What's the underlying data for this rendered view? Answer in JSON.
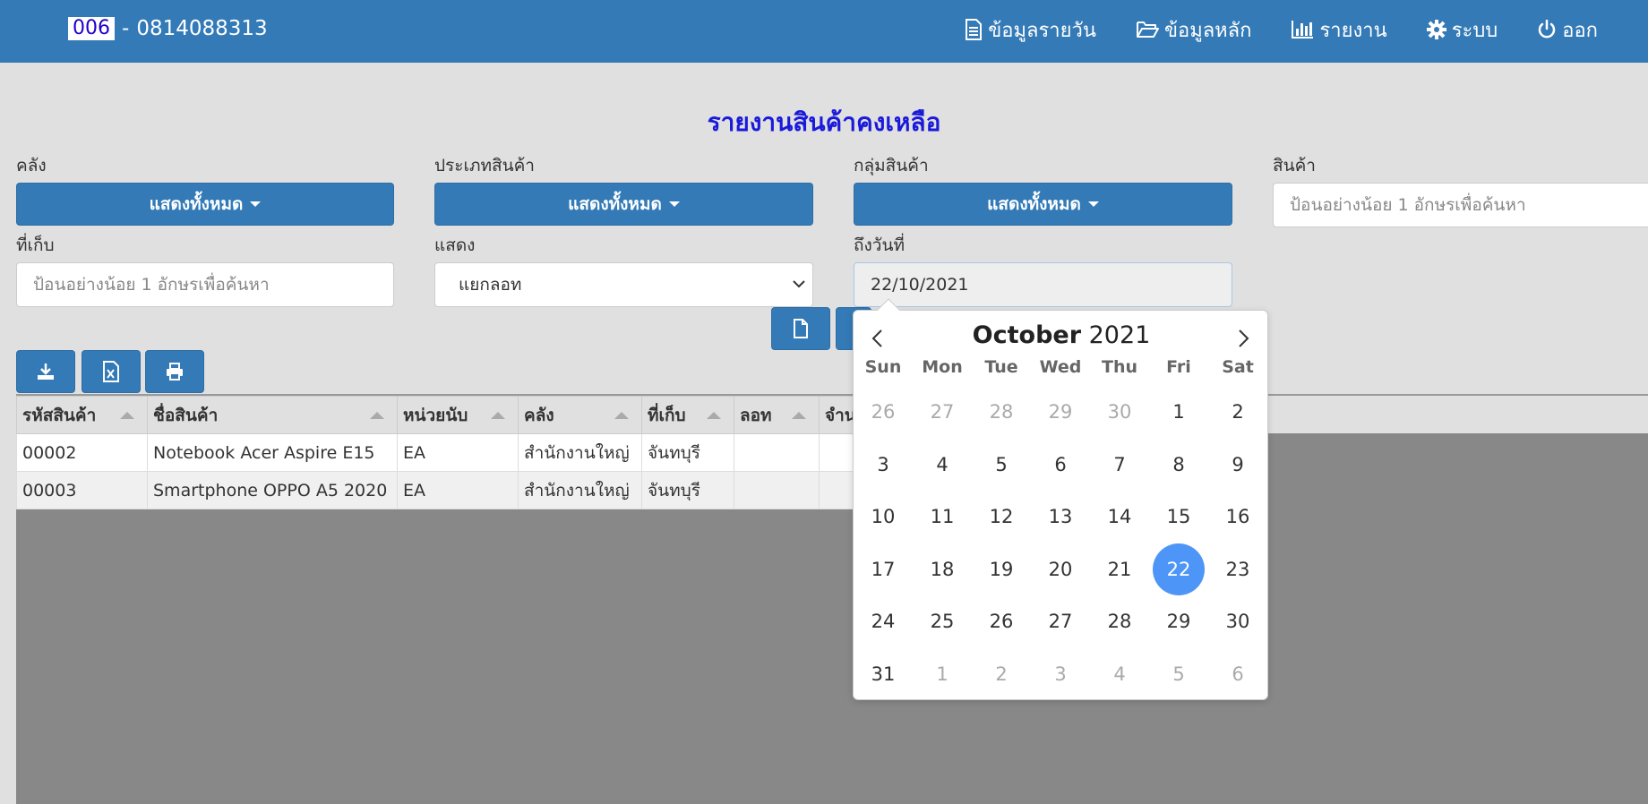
{
  "navbar": {
    "code": "006",
    "separator": "-",
    "phone": "0814088313",
    "items": [
      {
        "label": "ข้อมูลรายวัน",
        "icon": "file-text-icon"
      },
      {
        "label": "ข้อมูลหลัก",
        "icon": "folder-open-icon"
      },
      {
        "label": "รายงาน",
        "icon": "bar-chart-icon"
      },
      {
        "label": "ระบบ",
        "icon": "gear-icon"
      },
      {
        "label": "ออก",
        "icon": "power-icon"
      }
    ]
  },
  "page": {
    "title": "รายงานสินค้าคงเหลือ"
  },
  "filters": {
    "warehouse": {
      "label": "คลัง",
      "value": "แสดงทั้งหมด"
    },
    "product_type": {
      "label": "ประเภทสินค้า",
      "value": "แสดงทั้งหมด"
    },
    "product_group": {
      "label": "กลุ่มสินค้า",
      "value": "แสดงทั้งหมด"
    },
    "product": {
      "label": "สินค้า",
      "placeholder": "ป้อนอย่างน้อย 1 อักษรเพื่อค้นหา"
    },
    "location": {
      "label": "ที่เก็บ",
      "placeholder": "ป้อนอย่างน้อย 1 อักษรเพื่อค้นหา"
    },
    "display": {
      "label": "แสดง",
      "value": "แยกลอท"
    },
    "to_date": {
      "label": "ถึงวันที่",
      "value": "22/10/2021"
    }
  },
  "toolbar": {
    "buttons": [
      {
        "icon": "download-icon"
      },
      {
        "icon": "excel-file-icon"
      },
      {
        "icon": "print-icon"
      }
    ],
    "action_icon": "document-icon"
  },
  "table": {
    "columns": [
      "รหัสสินค้า",
      "ชื่อสินค้า",
      "หน่วยนับ",
      "คลัง",
      "ที่เก็บ",
      "ลอท",
      "จำน"
    ],
    "rows": [
      [
        "00002",
        "Notebook Acer Aspire E15",
        "EA",
        "สำนักงานใหญ่",
        "จันทบุรี",
        "",
        ""
      ],
      [
        "00003",
        "Smartphone OPPO A5 2020",
        "EA",
        "สำนักงานใหญ่",
        "จันทบุรี",
        "",
        ""
      ]
    ]
  },
  "datepicker": {
    "month": "October",
    "year": "2021",
    "weekdays": [
      "Sun",
      "Mon",
      "Tue",
      "Wed",
      "Thu",
      "Fri",
      "Sat"
    ],
    "selected_day": "22",
    "weeks": [
      [
        "26",
        "27",
        "28",
        "29",
        "30",
        "1",
        "2"
      ],
      [
        "3",
        "4",
        "5",
        "6",
        "7",
        "8",
        "9"
      ],
      [
        "10",
        "11",
        "12",
        "13",
        "14",
        "15",
        "16"
      ],
      [
        "17",
        "18",
        "19",
        "20",
        "21",
        "22",
        "23"
      ],
      [
        "24",
        "25",
        "26",
        "27",
        "28",
        "29",
        "30"
      ],
      [
        "31",
        "1",
        "2",
        "3",
        "4",
        "5",
        "6"
      ]
    ],
    "other_month_mask": [
      [
        true,
        true,
        true,
        true,
        true,
        false,
        false
      ],
      [
        false,
        false,
        false,
        false,
        false,
        false,
        false
      ],
      [
        false,
        false,
        false,
        false,
        false,
        false,
        false
      ],
      [
        false,
        false,
        false,
        false,
        false,
        false,
        false
      ],
      [
        false,
        false,
        false,
        false,
        false,
        false,
        false
      ],
      [
        false,
        true,
        true,
        true,
        true,
        true,
        true
      ]
    ]
  },
  "colors": {
    "primary": "#337ab7",
    "title": "#1a1adb",
    "selected_day": "#4d96f7",
    "page_bg": "#e0e0e0"
  }
}
